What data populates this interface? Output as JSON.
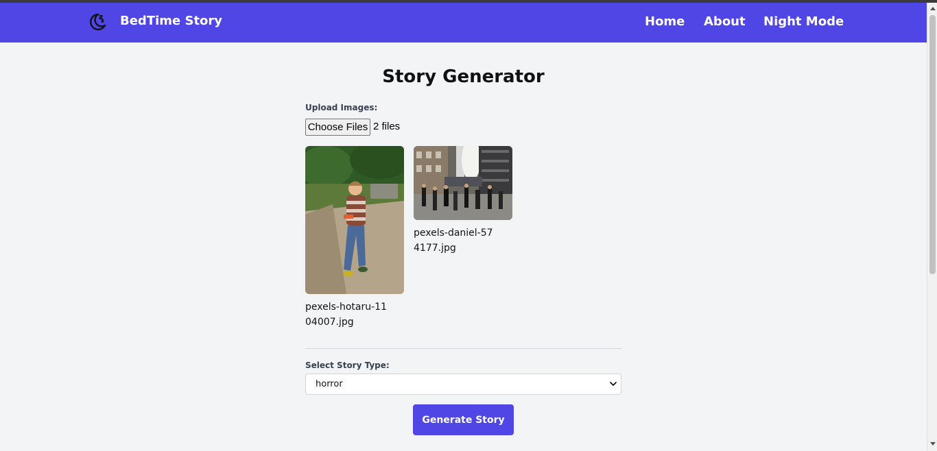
{
  "brand": {
    "title": "BedTime Story",
    "icon": "moon-sleep-icon"
  },
  "nav": {
    "home": "Home",
    "about": "About",
    "night_mode": "Night Mode"
  },
  "page": {
    "title": "Story Generator"
  },
  "upload": {
    "label": "Upload Images:",
    "button_label": "Choose Files",
    "file_count": "2 files",
    "files": [
      {
        "name": "pexels-hotaru-1104007.jpg"
      },
      {
        "name": "pexels-daniel-574177.jpg"
      }
    ]
  },
  "story_type": {
    "label": "Select Story Type:",
    "selected": "horror"
  },
  "generate": {
    "label": "Generate Story"
  },
  "colors": {
    "primary": "#4f46e5",
    "background": "#f3f4f6"
  }
}
